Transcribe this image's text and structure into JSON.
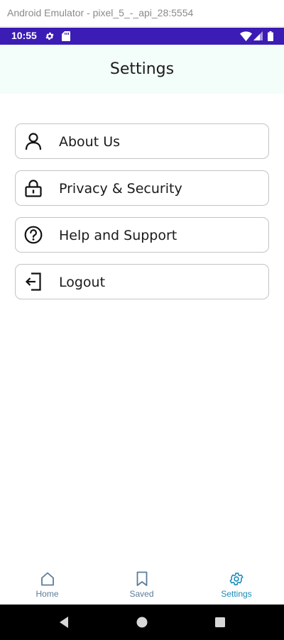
{
  "emulator": {
    "title": "Android Emulator - pixel_5_-_api_28:5554"
  },
  "status_bar": {
    "time": "10:55",
    "icons": [
      "gear-icon",
      "sd-card-icon",
      "wifi-icon",
      "signal-icon",
      "battery-icon"
    ],
    "background": "#3b1cb4"
  },
  "header": {
    "title": "Settings",
    "background": "#f3fdf9"
  },
  "menu": {
    "items": [
      {
        "label": "About Us",
        "icon": "person-icon"
      },
      {
        "label": "Privacy & Security",
        "icon": "lock-icon"
      },
      {
        "label": "Help and Support",
        "icon": "question-circle-icon"
      },
      {
        "label": "Logout",
        "icon": "logout-icon"
      }
    ]
  },
  "bottom_nav": {
    "items": [
      {
        "label": "Home",
        "icon": "home-icon",
        "active": false
      },
      {
        "label": "Saved",
        "icon": "bookmark-icon",
        "active": false
      },
      {
        "label": "Settings",
        "icon": "gear-icon",
        "active": true
      }
    ],
    "inactive_color": "#5b7c99",
    "active_color": "#1a8cb8"
  },
  "system_nav": {
    "buttons": [
      "back-icon",
      "home-circle-icon",
      "recents-icon"
    ]
  }
}
